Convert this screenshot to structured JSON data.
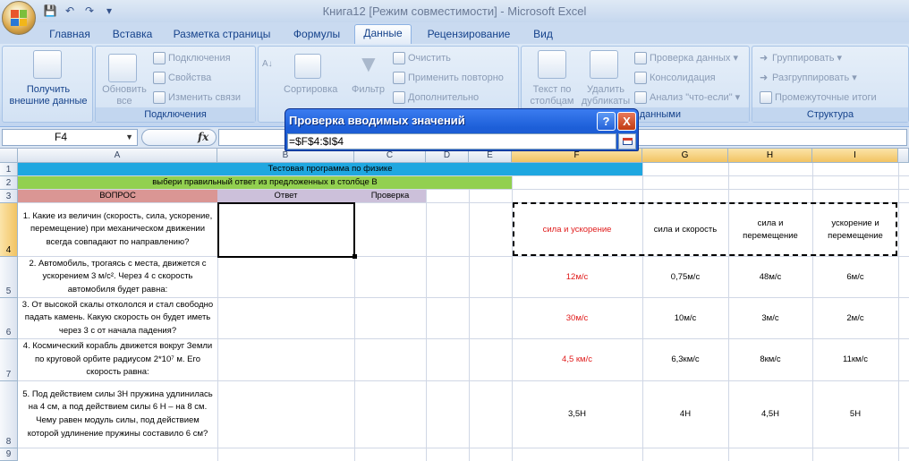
{
  "window": {
    "title": "Книга12  [Режим совместимости] - Microsoft Excel"
  },
  "tabs": [
    "Главная",
    "Вставка",
    "Разметка страницы",
    "Формулы",
    "Данные",
    "Рецензирование",
    "Вид"
  ],
  "active_tab": "Данные",
  "ribbon": {
    "get_external": "Получить внешние данные",
    "refresh_all": "Обновить все",
    "connections": "Подключения",
    "properties": "Свойства",
    "edit_links": "Изменить связи",
    "group_connections": "Подключения",
    "sort": "Сортировка",
    "filter": "Фильтр",
    "clear": "Очистить",
    "reapply": "Применить повторно",
    "advanced": "Дополнительно",
    "text_to_columns": "Текст по столбцам",
    "remove_duplicates": "Удалить дубликаты",
    "data_validation": "Проверка данных",
    "consolidate": "Консолидация",
    "what_if": "Анализ \"что-если\"",
    "group_data": "данными",
    "group_btn": "Группировать",
    "ungroup_btn": "Разгруппировать",
    "subtotals": "Промежуточные итоги",
    "group_structure": "Структура"
  },
  "formula_bar": {
    "name_box": "F4",
    "fx": "fx",
    "content": ""
  },
  "dialog": {
    "title": "Проверка вводимых значений",
    "help": "?",
    "close": "X",
    "input": "=$F$4:$I$4"
  },
  "columns": [
    "A",
    "B",
    "C",
    "D",
    "E",
    "F",
    "G",
    "H",
    "I"
  ],
  "rows": [
    "1",
    "2",
    "3",
    "4",
    "5",
    "6",
    "7",
    "8",
    "9"
  ],
  "sheet": {
    "r1": "Тестовая программа по физике",
    "r2": "выбери правильный ответ из предложенных в столбце В",
    "r3": {
      "a": "ВОПРОС",
      "b": "Ответ",
      "c": "Проверка"
    },
    "questions": [
      "1. Какие из величин (скорость, сила, ускорение, перемещение) при механическом движении всегда совпадают по направлению?",
      "2. Автомобиль, трогаясь с места, движется с ускорением 3 м/с². Через 4 с скорость автомобиля будет равна:",
      "3. От высокой скалы откололся и стал свободно падать камень. Какую скорость он будет иметь через 3 с от начала падения?",
      "4. Космический корабль движется вокруг Земли по круговой орбите радиусом 2*10⁷ м. Его скорость равна:",
      "5. Под действием силы 3Н пружина удлинилась на 4 см, а под действием силы 6 Н – на 8 см. Чему равен модуль силы, под действием  которой удлинение пружины составило 6 см?"
    ],
    "options": [
      [
        "сила и ускорение",
        "сила и скорость",
        "сила и перемещение",
        "ускорение и перемещение"
      ],
      [
        "12м/с",
        "0,75м/с",
        "48м/с",
        "6м/с"
      ],
      [
        "30м/с",
        "10м/с",
        "3м/с",
        "2м/с"
      ],
      [
        "4,5 км/с",
        "6,3км/с",
        "8км/с",
        "11км/с"
      ],
      [
        "3,5Н",
        "4Н",
        "4,5Н",
        "5Н"
      ]
    ]
  },
  "colors": {
    "title_row": "#1fa7e0",
    "hint_row": "#92d050",
    "question_header": "#da9694",
    "answer_header": "#ccc0da",
    "correct": "#e01b1b"
  }
}
